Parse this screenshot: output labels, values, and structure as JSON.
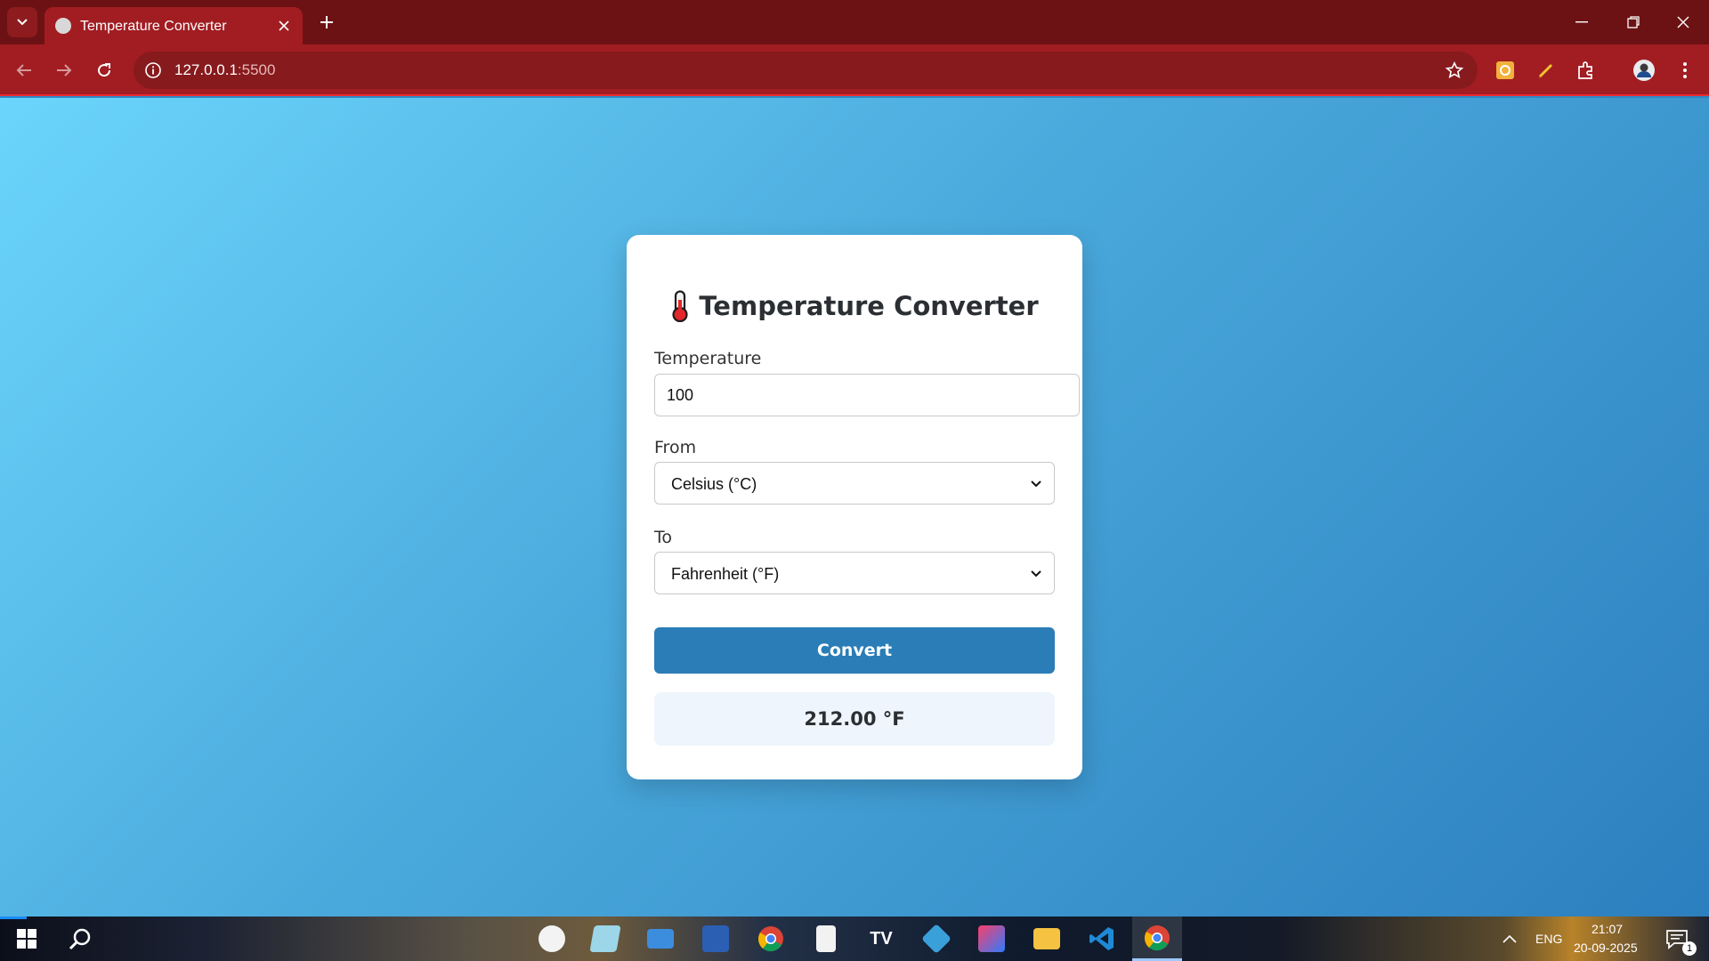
{
  "browser": {
    "tab_title": "Temperature Converter",
    "url_host": "127.0.0.1",
    "url_port": ":5500"
  },
  "card": {
    "title": "Temperature Converter",
    "temperature_label": "Temperature",
    "temperature_value": "100",
    "from_label": "From",
    "from_selected": "Celsius (°C)",
    "to_label": "To",
    "to_selected": "Fahrenheit (°F)",
    "convert_label": "Convert",
    "result": "212.00 °F"
  },
  "taskbar": {
    "language": "ENG",
    "time": "21:07",
    "date": "20-09-2025",
    "notification_count": "1"
  },
  "colors": {
    "browser_frame": "#6d1214",
    "browser_toolbar": "#a11d22",
    "button": "#2a7db7",
    "result_bg": "#eef5fc",
    "page_gradient_start": "#6bd5fb",
    "page_gradient_end": "#2c7fbe"
  },
  "icons": [
    "tab-search-icon",
    "globe-icon",
    "close-icon",
    "plus-icon",
    "minimize-icon",
    "restore-icon",
    "back-icon",
    "forward-icon",
    "reload-icon",
    "info-icon",
    "star-icon",
    "extension-icon",
    "puzzle-icon",
    "profile-icon",
    "menu-icon",
    "thermometer-icon",
    "chevron-down-icon",
    "windows-start-icon",
    "search-icon"
  ]
}
